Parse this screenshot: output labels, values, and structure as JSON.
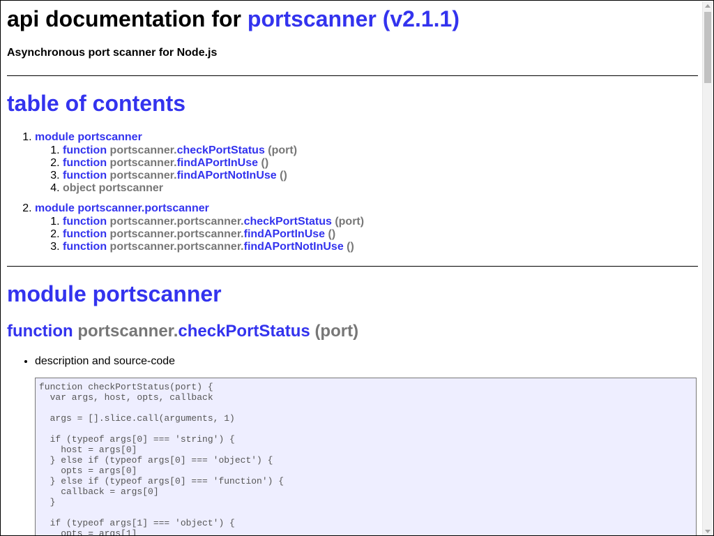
{
  "title": {
    "prefix": "api documentation for ",
    "package": "portscanner (v2.1.1)"
  },
  "subtitle": "Asynchronous port scanner for Node.js",
  "toc": {
    "heading": "table of contents",
    "modules": [
      {
        "label": "module portscanner",
        "items": [
          {
            "kind": "function",
            "ns": "portscanner.",
            "name": "checkPortStatus",
            "args": "(port)"
          },
          {
            "kind": "function",
            "ns": "portscanner.",
            "name": "findAPortInUse",
            "args": "()"
          },
          {
            "kind": "function",
            "ns": "portscanner.",
            "name": "findAPortNotInUse",
            "args": "()"
          },
          {
            "kind": "object",
            "text": "object portscanner"
          }
        ]
      },
      {
        "label": "module portscanner.portscanner",
        "items": [
          {
            "kind": "function",
            "ns": "portscanner.portscanner.",
            "name": "checkPortStatus",
            "args": "(port)"
          },
          {
            "kind": "function",
            "ns": "portscanner.portscanner.",
            "name": "findAPortInUse",
            "args": "()"
          },
          {
            "kind": "function",
            "ns": "portscanner.portscanner.",
            "name": "findAPortNotInUse",
            "args": "()"
          }
        ]
      }
    ]
  },
  "section": {
    "module_heading": "module portscanner",
    "function_heading": {
      "kind": "function",
      "ns": "portscanner.",
      "name": "checkPortStatus",
      "args": "(port)"
    },
    "bullet": "description and source-code",
    "code": "function checkPortStatus(port) {\n  var args, host, opts, callback\n\n  args = [].slice.call(arguments, 1)\n\n  if (typeof args[0] === 'string') {\n    host = args[0]\n  } else if (typeof args[0] === 'object') {\n    opts = args[0]\n  } else if (typeof args[0] === 'function') {\n    callback = args[0]\n  }\n\n  if (typeof args[1] === 'object') {\n    opts = args[1]"
  },
  "colors": {
    "link": "#3333ee",
    "muted": "#777777",
    "code_bg": "#eeeeff"
  }
}
